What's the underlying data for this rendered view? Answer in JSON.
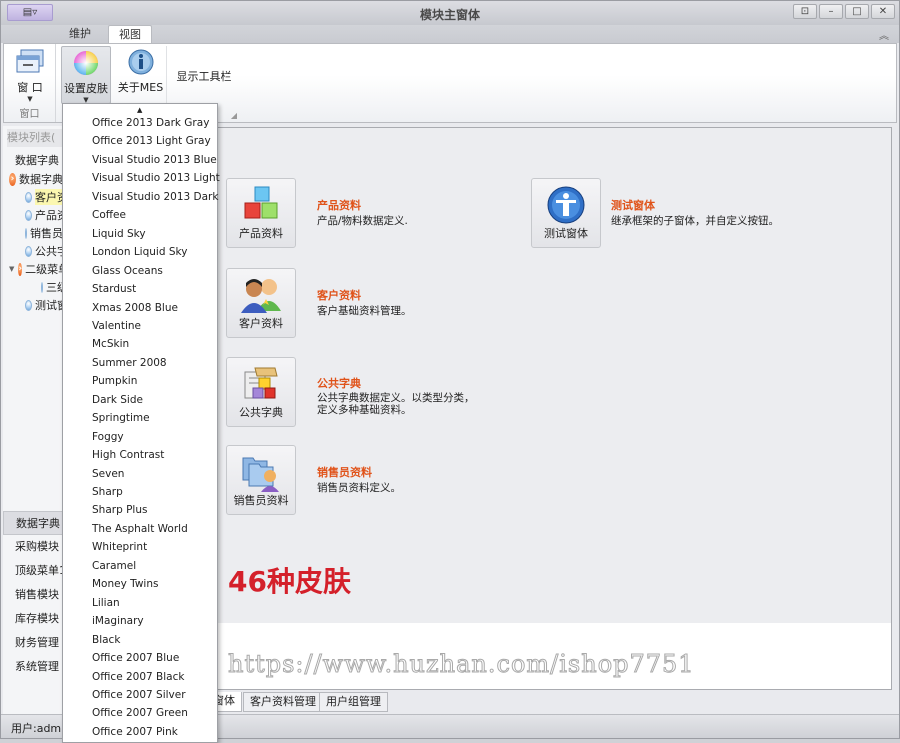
{
  "window": {
    "title": "模块主窗体",
    "quick_access_label": "▤▿",
    "controls": [
      "⊡",
      "–",
      "□",
      "✕"
    ],
    "collapse_icon": "︽"
  },
  "ribbon": {
    "tabs": [
      {
        "label": "维护",
        "active": false
      },
      {
        "label": "视图",
        "active": true
      }
    ],
    "groups": [
      {
        "label": "窗口",
        "buttons": [
          {
            "label": "窗 口",
            "icon": "window-icon"
          }
        ]
      },
      {
        "label": "",
        "buttons": [
          {
            "label": "设置皮肤",
            "icon": "color-wheel-icon"
          },
          {
            "label": "关于MES",
            "icon": "info-icon"
          },
          {
            "label": "显示工具栏",
            "icon": ""
          }
        ]
      }
    ]
  },
  "left_panel": {
    "header": "模块列表(",
    "subtitle": "数据字典",
    "tree": [
      {
        "label": "数据字典",
        "icon": "orange-arrow-icon",
        "level": 0
      },
      {
        "label": "客户资料",
        "icon": "blue-bubble-icon",
        "level": 1,
        "highlighted": true
      },
      {
        "label": "产品资料",
        "icon": "blue-bubble-icon",
        "level": 1
      },
      {
        "label": "销售员资料",
        "icon": "blue-bubble-icon",
        "level": 1
      },
      {
        "label": "公共字典",
        "icon": "blue-bubble-icon",
        "level": 1
      },
      {
        "label": "二级菜单",
        "icon": "orange-arrow-icon",
        "level": 0,
        "expanded": true
      },
      {
        "label": "三级",
        "icon": "blue-bubble-icon",
        "level": 2
      },
      {
        "label": "测试窗体",
        "icon": "blue-bubble-icon",
        "level": 1
      }
    ],
    "nav": [
      {
        "label": "数据字典",
        "active": true
      },
      {
        "label": "采购模块"
      },
      {
        "label": "顶级菜单1"
      },
      {
        "label": "销售模块"
      },
      {
        "label": "库存模块"
      },
      {
        "label": "财务管理"
      },
      {
        "label": "系统管理"
      }
    ]
  },
  "skin_menu": {
    "items": [
      "Office 2013 Dark Gray",
      "Office 2013 Light Gray",
      "Visual Studio 2013 Blue",
      "Visual Studio 2013 Light",
      "Visual Studio 2013 Dark",
      "Coffee",
      "Liquid Sky",
      "London Liquid Sky",
      "Glass Oceans",
      "Stardust",
      "Xmas 2008 Blue",
      "Valentine",
      "McSkin",
      "Summer 2008",
      "Pumpkin",
      "Dark Side",
      "Springtime",
      "Foggy",
      "High Contrast",
      "Seven",
      "Sharp",
      "Sharp Plus",
      "The Asphalt World",
      "Whiteprint",
      "Caramel",
      "Money Twins",
      "Lilian",
      "iMaginary",
      "Black",
      "Office 2007 Blue",
      "Office 2007 Black",
      "Office 2007 Silver",
      "Office 2007 Green",
      "Office 2007 Pink"
    ]
  },
  "content": {
    "cards": [
      {
        "label": "产品资料",
        "title": "产品资料",
        "desc": "产品/物料数据定义.",
        "icon": "cubes-icon"
      },
      {
        "label": "客户资料",
        "title": "客户资料",
        "desc": "客户基础资料管理。",
        "icon": "people-icon"
      },
      {
        "label": "公共字典",
        "title": "公共字典",
        "desc": "公共字典数据定义。以类型分类，",
        "desc2": "定义多种基础资料。",
        "icon": "dictionary-icon"
      },
      {
        "label": "销售员资料",
        "title": "销售员资料",
        "desc": "销售员资料定义。",
        "icon": "salesperson-icon"
      },
      {
        "label": "测试窗体",
        "title": "测试窗体",
        "desc": "继承框架的子窗体，并自定义按钮。",
        "icon": "accessibility-icon"
      }
    ],
    "promo": "46种皮肤",
    "watermark": "https://www.huzhan.com/ishop7751"
  },
  "bottom_tabs": [
    {
      "label": "窗体",
      "active": true
    },
    {
      "label": "客户资料管理"
    },
    {
      "label": "用户组管理"
    }
  ],
  "status": {
    "user": "用户:admin"
  },
  "colors": {
    "accent_orange": "#e0531a",
    "promo_red": "#d4202a"
  }
}
